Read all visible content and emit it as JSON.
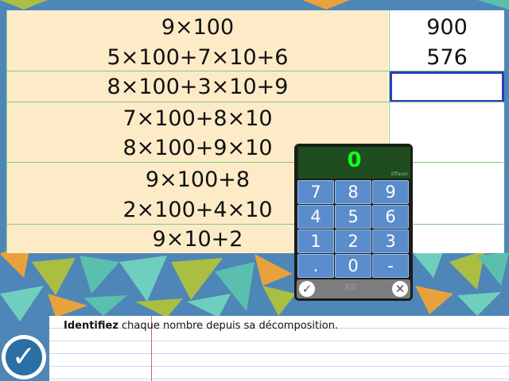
{
  "exercise": {
    "rows": [
      {
        "lines": [
          "9×100",
          "5×100+7×10+6"
        ],
        "answers": [
          "900",
          "576"
        ]
      },
      {
        "lines": [
          "8×100+3×10+9"
        ],
        "answers": [
          ""
        ]
      },
      {
        "lines": [
          "7×100+8×10",
          "8×100+9×10"
        ],
        "answers": [
          "",
          ""
        ]
      },
      {
        "lines": [
          "9×100+8",
          "2×100+4×10"
        ],
        "answers": [
          "",
          ""
        ]
      },
      {
        "lines": [
          "9×10+2"
        ],
        "answers": [
          ""
        ]
      }
    ]
  },
  "keypad": {
    "display": "0",
    "clear_label": "Effacer",
    "keys": [
      "7",
      "8",
      "9",
      "4",
      "5",
      "6",
      "1",
      "2",
      "3",
      ".",
      "0",
      "-"
    ],
    "ok_icon": "check-icon",
    "cancel_icon": "close-icon"
  },
  "instruction": {
    "bold": "Identifiez",
    "rest": " chaque nombre depuis sa décomposition."
  },
  "validate_icon": "check-icon",
  "colors": {
    "expression_bg": "#fdebc8",
    "active_border": "#2a3fc0",
    "key_bg": "#5b8dcc",
    "display_text": "#16ff16"
  }
}
